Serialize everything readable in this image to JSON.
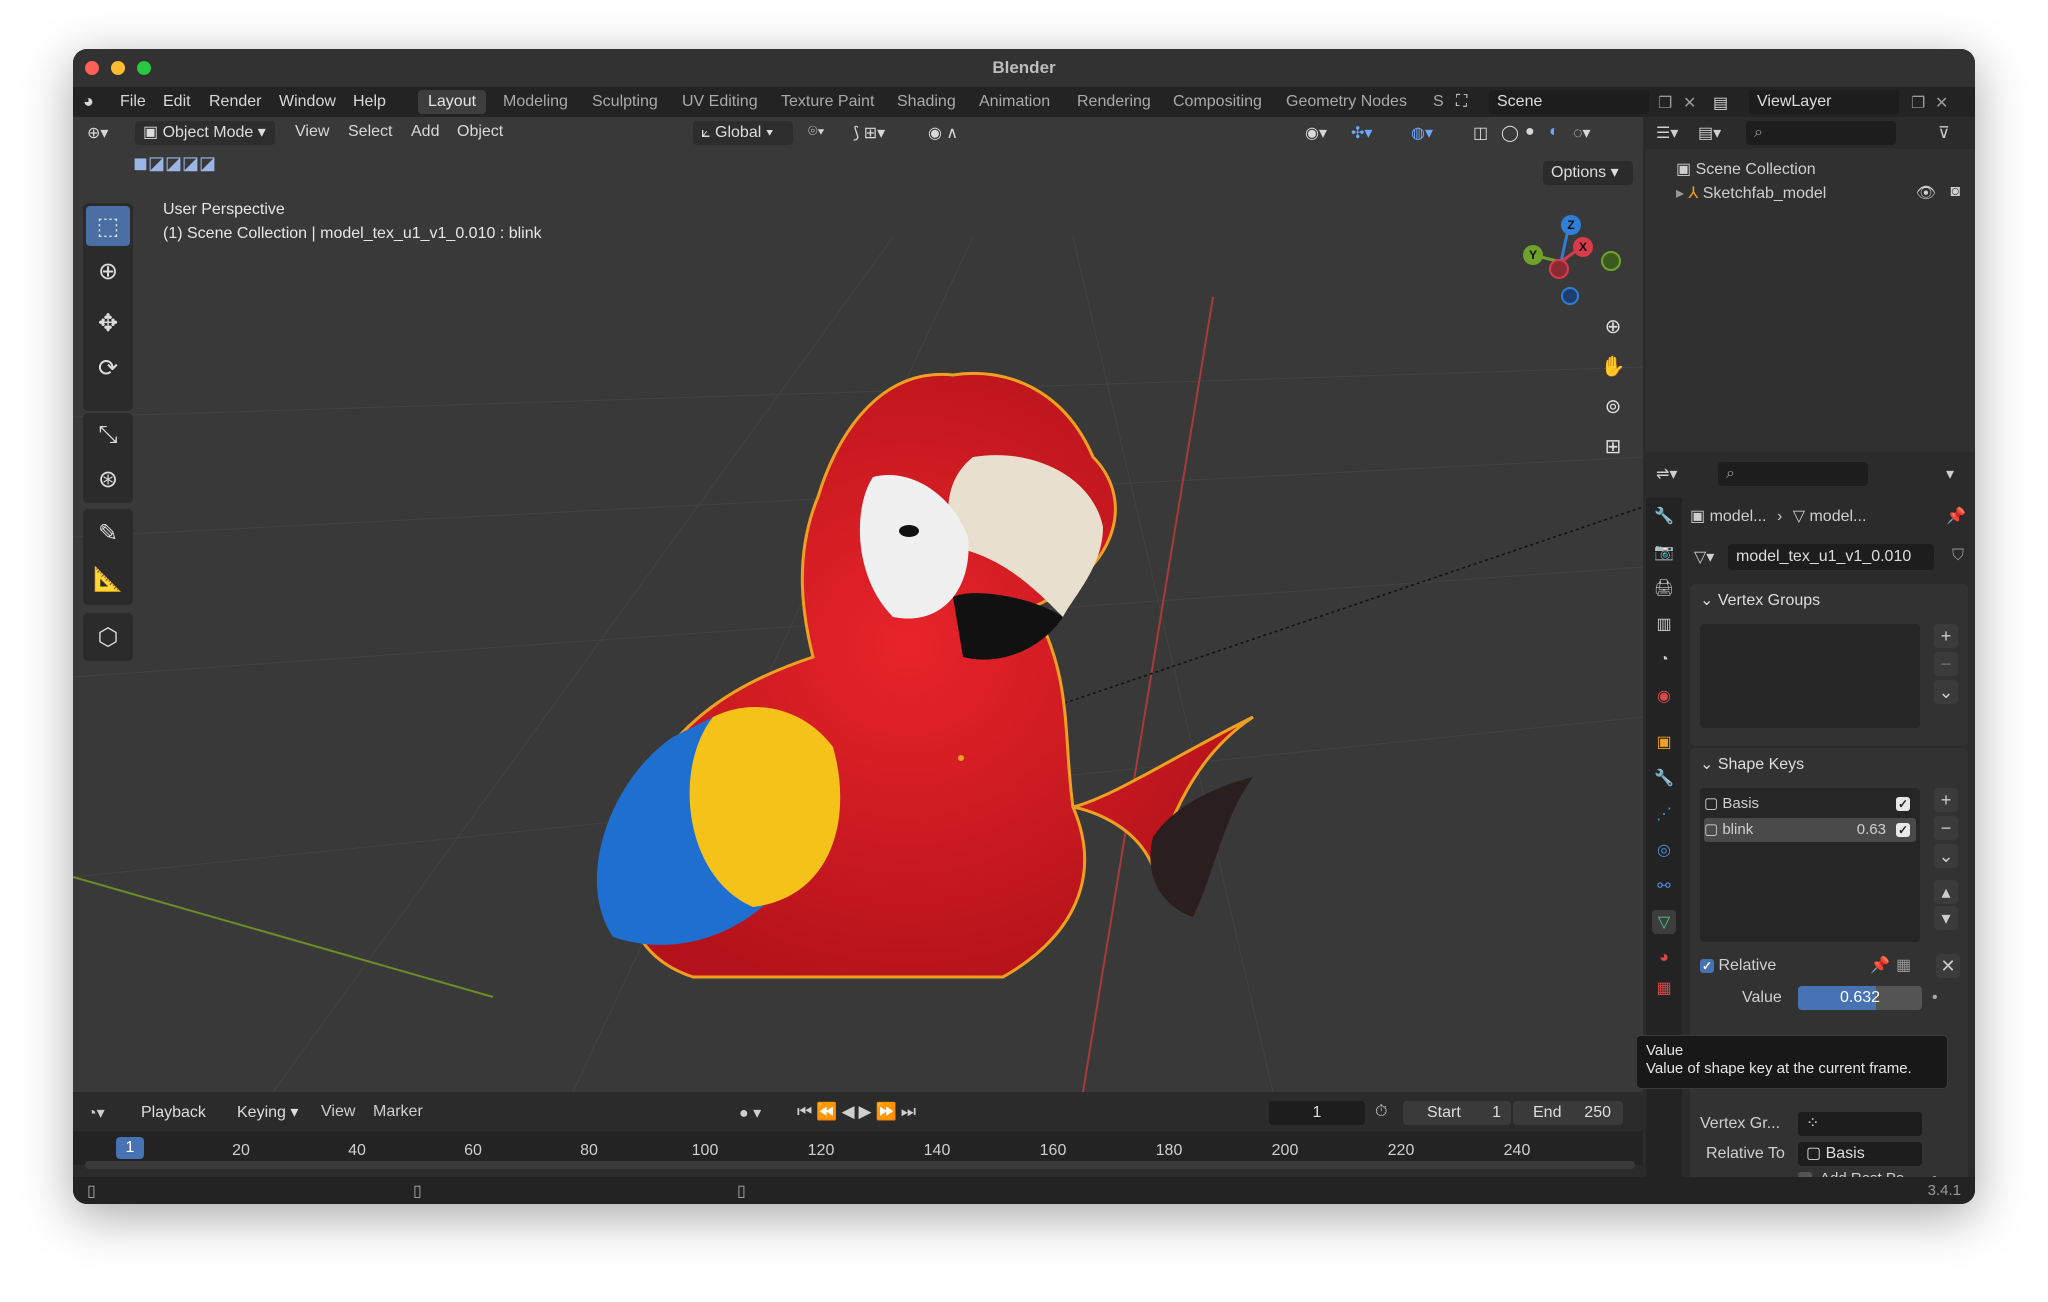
{
  "window": {
    "title": "Blender"
  },
  "menu": [
    "File",
    "Edit",
    "Render",
    "Window",
    "Help"
  ],
  "workspaces": [
    "Layout",
    "Modeling",
    "Sculpting",
    "UV Editing",
    "Texture Paint",
    "Shading",
    "Animation",
    "Rendering",
    "Compositing",
    "Geometry Nodes",
    "S"
  ],
  "scene": "Scene",
  "view_layer": "ViewLayer",
  "viewport": {
    "mode": "Object Mode",
    "menus": [
      "View",
      "Select",
      "Add",
      "Object"
    ],
    "orientation": "Global",
    "options_label": "Options",
    "info_line1": "User Perspective",
    "info_line2": "(1) Scene Collection | model_tex_u1_v1_0.010 : blink",
    "gizmo_labels": {
      "z": "Z",
      "y": "Y",
      "x": "X"
    }
  },
  "outliner": {
    "scene_collection": "Scene Collection",
    "item": "Sketchfab_model"
  },
  "properties": {
    "breadcrumb_object": "model...",
    "breadcrumb_mesh": "model...",
    "mesh_name": "model_tex_u1_v1_0.010",
    "vertex_groups_title": "Vertex Groups",
    "shape_keys_title": "Shape Keys",
    "shape_keys": [
      {
        "name": "Basis",
        "value": ""
      },
      {
        "name": "blink",
        "value": "0.63"
      }
    ],
    "relative_label": "Relative",
    "value_label": "Value",
    "value": "0.632",
    "value_fraction": 0.632,
    "vertex_group_label": "Vertex Gr...",
    "relative_to_label": "Relative To",
    "relative_to_value": "Basis",
    "add_rest_label": "Add Rest Po..."
  },
  "tooltip": {
    "title": "Value",
    "text": "Value of shape key at the current frame."
  },
  "timeline": {
    "menus": [
      "Playback",
      "Keying",
      "View",
      "Marker"
    ],
    "current_frame": "1",
    "start_label": "Start",
    "start": "1",
    "end_label": "End",
    "end": "250",
    "frame_marker": "1",
    "ticks": [
      "20",
      "40",
      "60",
      "80",
      "100",
      "120",
      "140",
      "160",
      "180",
      "200",
      "220",
      "240"
    ]
  },
  "status": {
    "version": "3.4.1"
  },
  "colors": {
    "accent_blue": "#4a6fa5",
    "selection_orange": "#f0a020",
    "value_slider": "#4772b3"
  }
}
